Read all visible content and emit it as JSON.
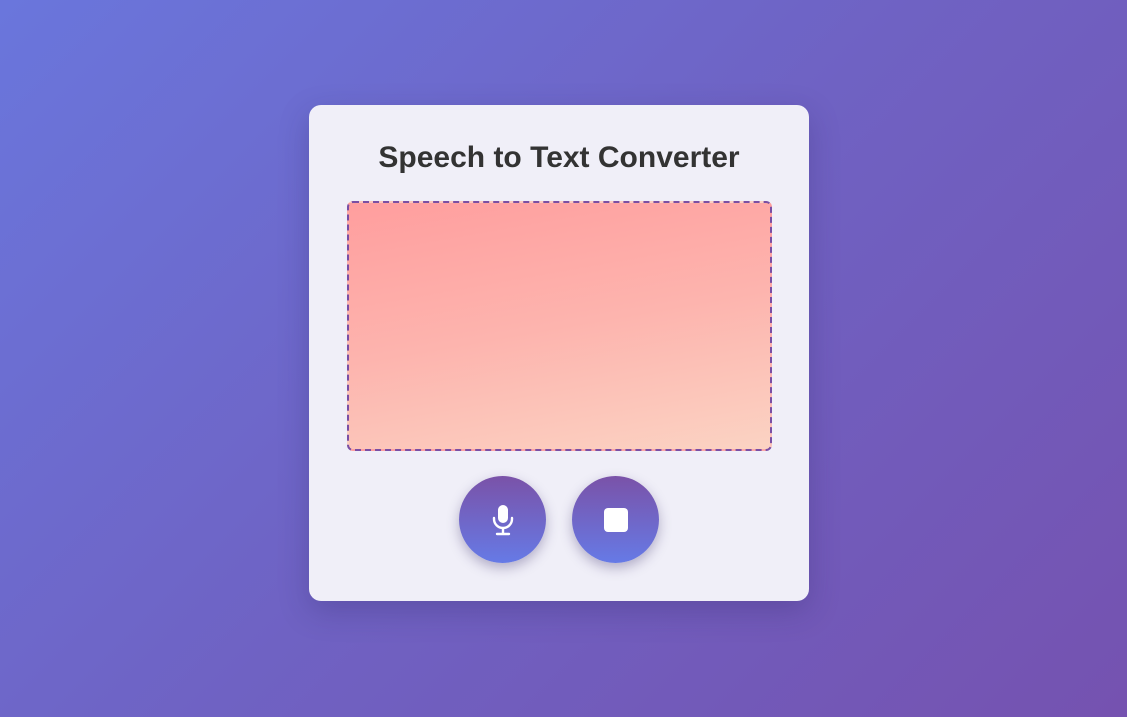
{
  "app": {
    "title": "Speech to Text Converter"
  },
  "transcript": {
    "text": ""
  },
  "controls": {
    "start_icon": "microphone-icon",
    "stop_icon": "stop-icon"
  },
  "colors": {
    "background_start": "#6a76dc",
    "background_end": "#7552b0",
    "card": "#f0eff8",
    "title": "#333333",
    "output_border": "#7a4fa4",
    "output_gradient_start": "#ff9e9e",
    "output_gradient_end": "#fbd3c3",
    "button_gradient_start": "#7a52a8",
    "button_gradient_end": "#667ae6"
  }
}
